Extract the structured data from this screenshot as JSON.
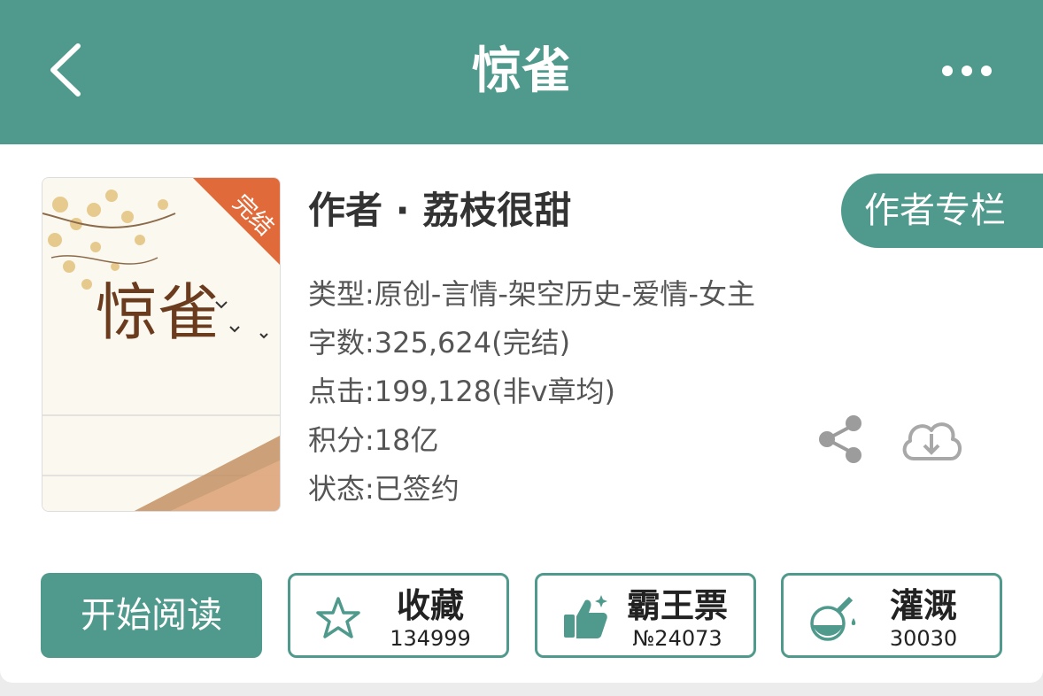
{
  "header": {
    "title": "惊雀",
    "back_icon": "chevron-left-icon",
    "more_icon": "more-dots-icon",
    "bg_color": "#4f9a8c"
  },
  "book": {
    "cover": {
      "badge": "完结",
      "cover_title": "惊雀"
    },
    "author_line": "作者 · 荔枝很甜",
    "author_button": "作者专栏",
    "type": "类型:原创-言情-架空历史-爱情-女主",
    "words": "字数:325,624(完结)",
    "clicks": "点击:199,128(非v章均)",
    "points": "积分:18亿",
    "status": "状态:已签约"
  },
  "actions": {
    "read": "开始阅读",
    "collect": {
      "label": "收藏",
      "count": "134999",
      "icon": "star-icon"
    },
    "vote": {
      "label": "霸王票",
      "count": "№24073",
      "icon": "thumbs-up-icon"
    },
    "water": {
      "label": "灌溉",
      "count": "30030",
      "icon": "flask-icon"
    }
  }
}
